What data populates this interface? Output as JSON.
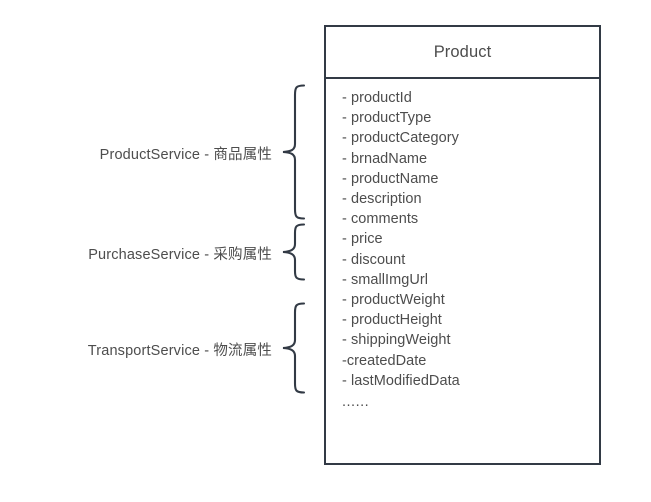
{
  "diagram": {
    "kind": "uml-class-grouping-diagram",
    "background_color": "#ffffff",
    "stroke_color": "#323a45",
    "text_color": "#4d4d4d",
    "class_box": {
      "title": "Product",
      "attributes": [
        "- productId",
        "- productType",
        "- productCategory",
        "- brnadName",
        "- productName",
        "- description",
        "- comments",
        "- price",
        "- discount",
        "- smallImgUrl",
        "- productWeight",
        "- productHeight",
        "- shippingWeight",
        "-createdDate",
        "- lastModifiedData"
      ],
      "more_indicator": "......"
    },
    "groups": [
      {
        "label": "ProductService - 商品属性",
        "service": "ProductService",
        "separator": "-",
        "category": "商品属性",
        "covers": [
          "- productId",
          "- productType",
          "- productCategory",
          "- brnadName",
          "- productName",
          "- description",
          "- comments"
        ],
        "brace_icon": "left-curly-brace-icon"
      },
      {
        "label": "PurchaseService - 采购属性",
        "service": "PurchaseService",
        "separator": "-",
        "category": "采购属性",
        "covers": [
          "- price",
          "- discount",
          "- smallImgUrl"
        ],
        "brace_icon": "left-curly-brace-icon"
      },
      {
        "label": "TransportService - 物流属性",
        "service": "TransportService",
        "separator": "-",
        "category": "物流属性",
        "covers": [
          "- productWeight",
          "- productHeight",
          "- shippingWeight",
          "-createdDate",
          "- lastModifiedData"
        ],
        "brace_icon": "left-curly-brace-icon"
      }
    ]
  }
}
